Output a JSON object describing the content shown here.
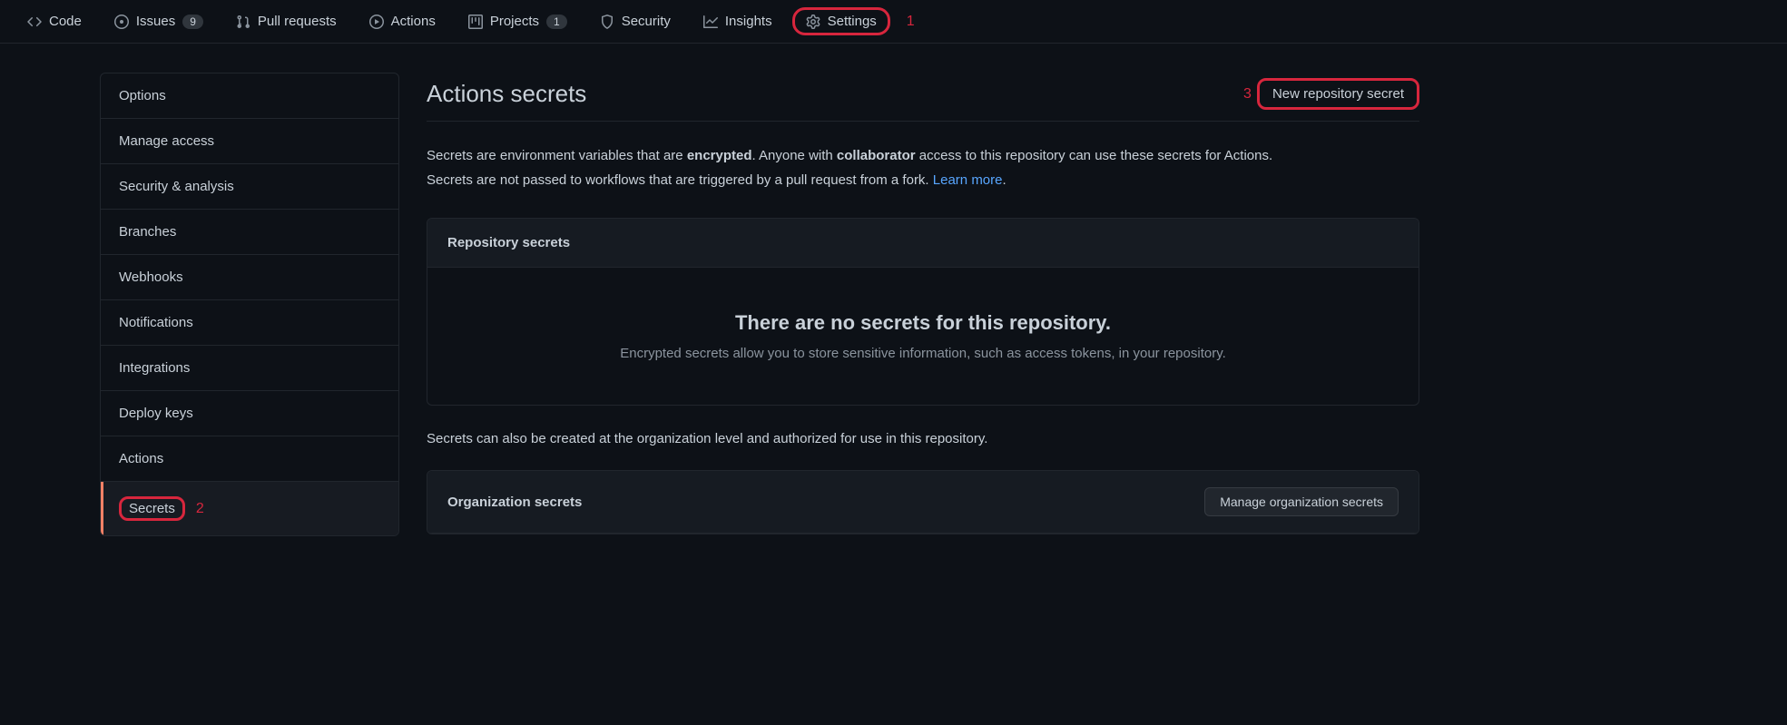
{
  "nav": {
    "code": "Code",
    "issues": "Issues",
    "issues_count": "9",
    "pulls": "Pull requests",
    "actions": "Actions",
    "projects": "Projects",
    "projects_count": "1",
    "security": "Security",
    "insights": "Insights",
    "settings": "Settings"
  },
  "annotations": {
    "a1": "1",
    "a2": "2",
    "a3": "3"
  },
  "sidebar": {
    "options": "Options",
    "manage_access": "Manage access",
    "security_analysis": "Security & analysis",
    "branches": "Branches",
    "webhooks": "Webhooks",
    "notifications": "Notifications",
    "integrations": "Integrations",
    "deploy_keys": "Deploy keys",
    "actions": "Actions",
    "secrets": "Secrets"
  },
  "main": {
    "title": "Actions secrets",
    "new_secret_btn": "New repository secret",
    "desc_p1a": "Secrets are environment variables that are ",
    "desc_bold1": "encrypted",
    "desc_p1b": ". Anyone with ",
    "desc_bold2": "collaborator",
    "desc_p1c": " access to this repository can use these secrets for Actions.",
    "desc_p2a": "Secrets are not passed to workflows that are triggered by a pull request from a fork. ",
    "learn_more": "Learn more",
    "period": ".",
    "repo_secrets_title": "Repository secrets",
    "empty_title": "There are no secrets for this repository.",
    "empty_sub": "Encrypted secrets allow you to store sensitive information, such as access tokens, in your repository.",
    "org_note": "Secrets can also be created at the organization level and authorized for use in this repository.",
    "org_secrets_title": "Organization secrets",
    "manage_org_btn": "Manage organization secrets"
  }
}
